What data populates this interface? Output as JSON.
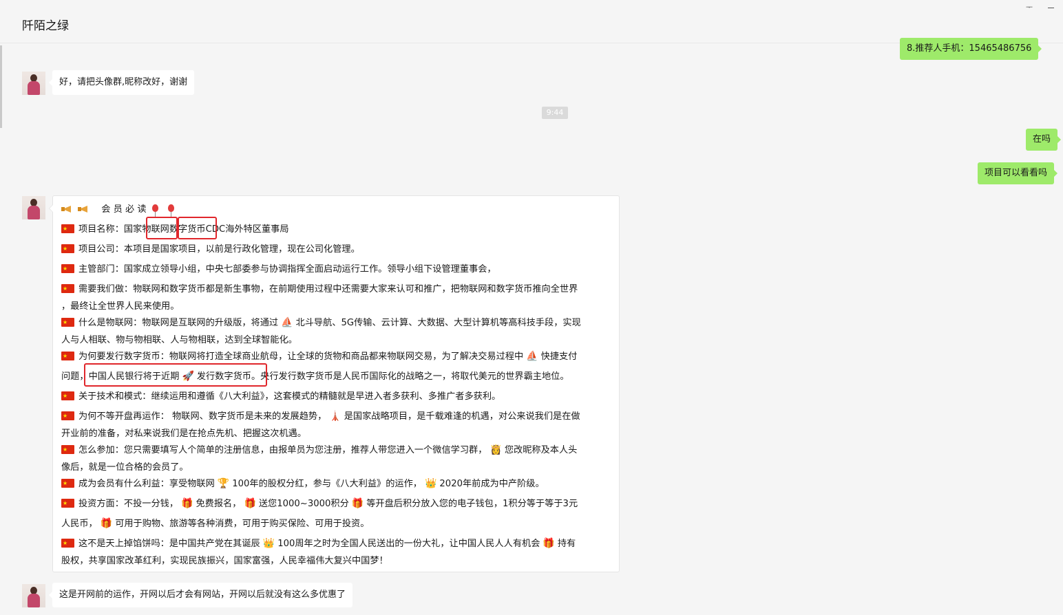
{
  "window": {
    "title": "阡陌之绿",
    "pin_glyph": "ᅮ"
  },
  "timestamp": "9:44",
  "messages_right": [
    {
      "text": "8.推荐人手机：15465486756"
    },
    {
      "text": "在吗"
    },
    {
      "text": "项目可以看看吗"
    }
  ],
  "messages_left": [
    {
      "text": "好，请把头像群,昵称改好，谢谢"
    },
    {
      "text": "这是开网前的运作，开网以后才会有网站，开网以后就没有这么多优惠了"
    }
  ],
  "announcement": {
    "heading": "会 员 必 读",
    "lines": [
      {
        "pre": "项目名称：国家",
        "a": "物联网",
        "b": "数字货币",
        "post": "CDC海外特区董事局"
      },
      "项目公司：本项目是国家项目，以前是行政化管理，现在公司化管理。",
      "主管部门：国家成立领导小组，中央七部委参与协调指挥全面启动运行工作。领导小组下设管理董事会，",
      "需要我们做：物联网和数字货币都是新生事物，在前期使用过程中还需要大家来认可和推广，把物联网和数字货币推向全世界",
      "，最终让全世界人民来使用。",
      {
        "pre": "什么是物联网：物联网是互联网的升级版，将通过",
        "post": "北斗导航、5G传输、云计算、大数据、大型计算机等高科技手段，实现"
      },
      "人与人相联、物与物相联、人与物相联，达到全球智能化。",
      {
        "pre": "为何要发行数字货币：物联网将打造全球商业航母，让全球的货物和商品都来物联网交易，为了解决交易过程中",
        "post": "快捷支付"
      },
      {
        "pre": "问题，",
        "a": "中国人民银行将于近期",
        "b": "发行数字货币",
        "post": "。央行发行数字货币是人民币国际化的战略之一，将取代美元的世界霸主地位。"
      },
      "关于技术和模式：继续运用和遵循《八大利益》，这套模式的精髓就是早进入者多获利、多推广者多获利。",
      {
        "pre": "为何不等开盘再运作： 物联网、数字货币是未来的发展趋势，",
        "post": "是国家战略项目，是千载难逢的机遇，对公来说我们是在做"
      },
      "开业前的准备，对私来说我们是在抢点先机、把握这次机遇。",
      {
        "pre": "怎么参加：您只需要填写人个简单的注册信息，由报单员为您注册，推荐人带您进入一个微信学习群，",
        "post": "您改昵称及本人头"
      },
      "像后，就是一位合格的会员了。",
      {
        "pre": "成为会员有什么利益：享受物联网",
        "mid": "100年的股权分红，参与《八大利益》的运作，",
        "post": "2020年前成为中产阶级。"
      },
      {
        "pre": "投资方面：不投一分钱，",
        "m1": "免费报名，",
        "m2": "送您1000~3000积分",
        "post": "等开盘后积分放入您的电子钱包，1积分等于等于3元"
      },
      {
        "pre": "人民币，",
        "post": "可用于购物、旅游等各种消费，可用于购买保险、可用于投资。"
      },
      {
        "pre": "这不是天上掉馅饼吗：是中国共产党在其诞辰",
        "mid": "100周年之时为全国人民送出的一份大礼，让中国人民人人有机会",
        "post": "持有"
      },
      "股权，共享国家改革红利，实现民族振兴，国家富强，人民幸福伟大复兴中国梦！"
    ]
  },
  "icons": {
    "flag": "china-flag",
    "horn": "party-horn",
    "balloon": "red-balloon",
    "sailboat": "⛵",
    "rocket": "🚀",
    "tower": "🗼",
    "princess": "👸",
    "trophy": "🏆",
    "crown": "👑",
    "gift": "🎁"
  },
  "colors": {
    "my_bubble": "#9eea6a",
    "highlight_box": "#e0262b"
  }
}
